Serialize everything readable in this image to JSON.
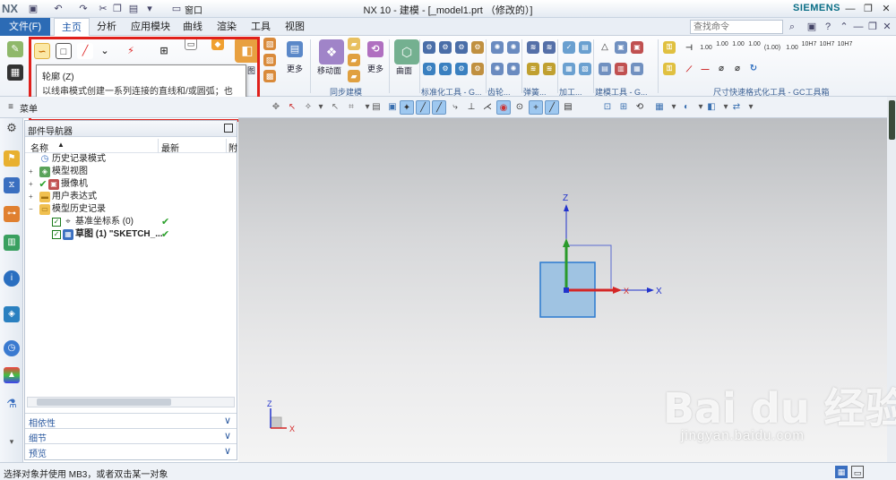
{
  "window": {
    "app_logo": "NX",
    "title": "NX 10 - 建模 - [_model1.prt （修改的）]",
    "brand": "SIEMENS",
    "quick_access_icons": [
      "save-icon",
      "undo-icon",
      "redo-icon",
      "cut-icon",
      "copy-icon",
      "paste-icon",
      "window-icon"
    ],
    "window_menu_label": "窗口",
    "controls": [
      "minimize",
      "restore",
      "close"
    ]
  },
  "menubar": {
    "file_label": "文件(F)",
    "tabs": [
      "主页",
      "分析",
      "应用模块",
      "曲线",
      "渲染",
      "工具",
      "视图"
    ],
    "active_tab": "主页",
    "search_placeholder": "查找命令"
  },
  "ribbon": {
    "labels": {
      "more1": "更多",
      "move_face": "移动面",
      "more2": "更多",
      "surface": "曲面",
      "partial_view": "图"
    },
    "groups": [
      "同步建模",
      "标准化工具 - G...",
      "齿轮...",
      "弹簧...",
      "加工...",
      "建模工具 - G...",
      "尺寸快速格式化工具 - GC工具箱"
    ],
    "dim_tools": [
      "1.00",
      "1.00",
      "1.00",
      "1.00",
      "(1.00)",
      "1.00",
      "10H7",
      "10H7",
      "10H7"
    ]
  },
  "tooltip": {
    "title": "轮廓 (Z)",
    "description": "以线串模式创建一系列连接的直线和/或圆弧；也就是说，上一条曲线的终点变成下一条曲线的起点。"
  },
  "seltoolbar": {
    "menu_label": "菜单"
  },
  "navigator": {
    "title": "部件导航器",
    "columns": [
      "名称",
      "最新",
      "附"
    ],
    "tree": [
      {
        "label": "历史记录模式",
        "depth": 0,
        "icon": "history-clock-icon",
        "expander": false,
        "checkbox": false,
        "latest": false
      },
      {
        "label": "模型视图",
        "depth": 0,
        "icon": "model-view-icon",
        "expander": true,
        "checkbox": false,
        "latest": false
      },
      {
        "label": "摄像机",
        "depth": 0,
        "icon": "camera-icon",
        "expander": true,
        "checkbox": false,
        "latest": false
      },
      {
        "label": "用户表达式",
        "depth": 0,
        "icon": "folder-icon",
        "expander": true,
        "checkbox": false,
        "latest": false
      },
      {
        "label": "模型历史记录",
        "depth": 0,
        "icon": "folder-open-icon",
        "expander": true,
        "checkbox": false,
        "latest": false
      },
      {
        "label": "基准坐标系 (0)",
        "depth": 1,
        "icon": "datum-csys-icon",
        "expander": false,
        "checkbox": true,
        "latest": true
      },
      {
        "label": "草图 (1) \"SKETCH_...",
        "depth": 1,
        "icon": "sketch-icon",
        "expander": false,
        "checkbox": true,
        "latest": true
      }
    ],
    "accordions": [
      "相依性",
      "细节",
      "预览"
    ]
  },
  "graphics": {
    "axis_x": "X",
    "axis_z": "Z",
    "triad_x": "X",
    "triad_z": "Z"
  },
  "statusbar": {
    "text": "选择对象并使用 MB3，或者双击某一对象"
  },
  "watermark": {
    "logo": "Bai du 经验",
    "url": "jingyan.baidu.com"
  },
  "colors": {
    "accent": "#2c6bb5",
    "highlight_red": "#e0201b",
    "axis_x": "#d42626",
    "axis_y": "#2a9a2a",
    "axis_z": "#2233cc",
    "sketch_fill": "#9fc3e2"
  }
}
